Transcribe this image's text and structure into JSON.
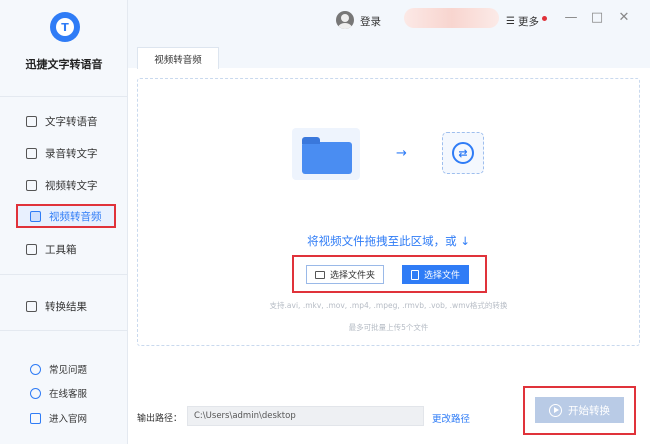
{
  "app": {
    "name": "迅捷文字转语音",
    "logo_letter": "T"
  },
  "sidebar": {
    "items": [
      {
        "label": "文字转语音",
        "icon": "text-doc-icon"
      },
      {
        "label": "录音转文字",
        "icon": "record-icon"
      },
      {
        "label": "视频转文字",
        "icon": "video-icon"
      },
      {
        "label": "视频转音频",
        "icon": "video-audio-icon",
        "active": true
      },
      {
        "label": "工具箱",
        "icon": "toolbox-icon"
      }
    ],
    "results_label": "转换结果",
    "help": [
      {
        "label": "常见问题",
        "icon": "question-icon"
      },
      {
        "label": "在线客服",
        "icon": "headset-icon"
      },
      {
        "label": "进入官网",
        "icon": "monitor-icon"
      }
    ]
  },
  "header": {
    "login_label": "登录",
    "more_label": "更多",
    "minimize": "—",
    "maximize": "□",
    "close": "✕"
  },
  "tab": {
    "label": "视频转音频"
  },
  "drop": {
    "arrow": "→",
    "convert_icon": "⇄",
    "prompt": "将视频文件拖拽至此区域，或 ↓",
    "choose_folder": "选择文件夹",
    "choose_file": "选择文件",
    "supported": "支持.avi, .mkv, .mov, .mp4, .mpeg, .rmvb, .vob, .wmv格式的转换",
    "limit": "最多可批量上传5个文件"
  },
  "output": {
    "label": "输出路径：",
    "path": "C:\\Users\\admin\\desktop",
    "change_label": "更改路径"
  },
  "start": {
    "label": "开始转换"
  },
  "colors": {
    "accent": "#2f7cf6",
    "highlight_red": "#e0323a",
    "disabled_button": "#b9cbe6"
  }
}
